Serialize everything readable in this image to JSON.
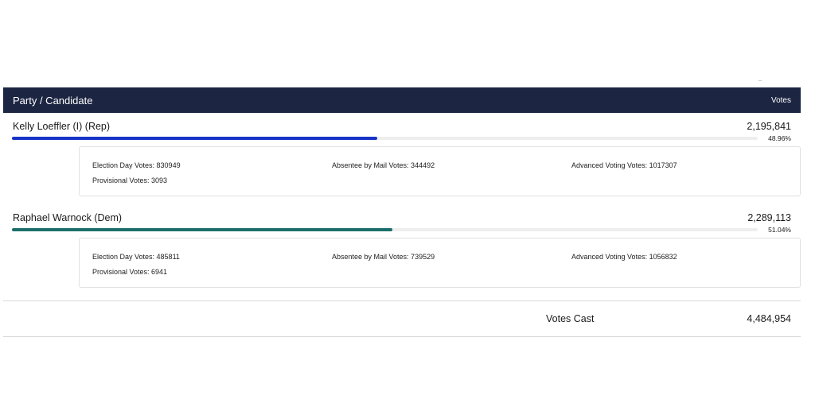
{
  "table": {
    "header": {
      "candidate_label": "Party / Candidate",
      "votes_label": "Votes"
    },
    "candidates": [
      {
        "name": "Kelly Loeffler (I) (Rep)",
        "votes": "2,195,841",
        "percent": "48.96%",
        "share": 0.4896,
        "color": "#1733c7",
        "details": {
          "election_day": "Election Day Votes: 830949",
          "absentee": "Absentee by Mail Votes: 344492",
          "advanced": "Advanced Voting Votes: 1017307",
          "provisional": "Provisional Votes: 3093"
        }
      },
      {
        "name": "Raphael Warnock (Dem)",
        "votes": "2,289,113",
        "percent": "51.04%",
        "share": 0.5104,
        "color": "#1b6f6b",
        "details": {
          "election_day": "Election Day Votes: 485811",
          "absentee": "Absentee by Mail Votes: 739529",
          "advanced": "Advanced Voting Votes: 1056832",
          "provisional": "Provisional Votes: 6941"
        }
      }
    ],
    "summary": {
      "label": "Votes Cast",
      "total": "4,484,954"
    }
  }
}
